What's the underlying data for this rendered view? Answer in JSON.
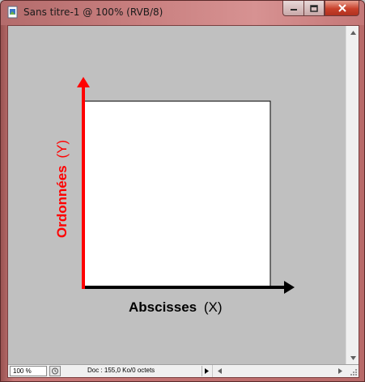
{
  "window": {
    "title": "Sans titre-1 @ 100% (RVB/8)",
    "frame_color": "#b86a69",
    "canvas_bg": "#c0c0c0"
  },
  "title_icon": "photoshop-document-icon",
  "window_buttons": [
    "minimize-icon",
    "maximize-icon",
    "close-icon"
  ],
  "drawing": {
    "y_axis_label_bold": "Ordonnées",
    "y_axis_label_suffix": "(Y)",
    "x_axis_label_bold": "Abscisses",
    "x_axis_label_suffix": "(X)",
    "y_axis_color": "#ff0000",
    "x_axis_color": "#000000"
  },
  "statusbar": {
    "zoom": "100 %",
    "doc_info": "Doc : 155,0 Ko/0 octets"
  }
}
